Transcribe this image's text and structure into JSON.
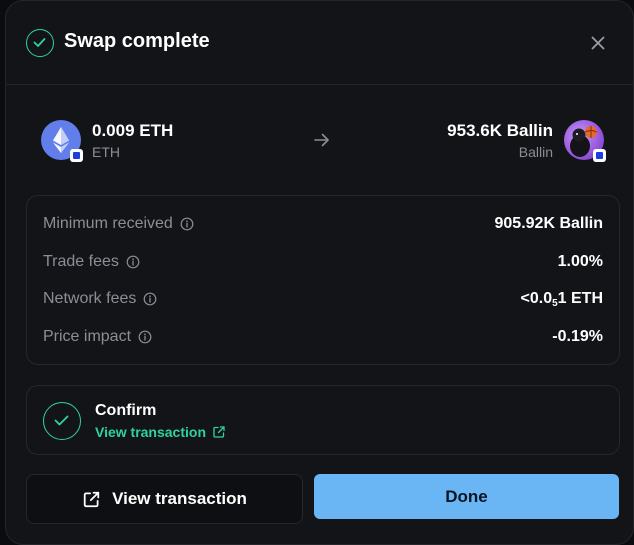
{
  "header": {
    "title": "Swap complete"
  },
  "swap": {
    "from": {
      "amount": "0.009 ETH",
      "symbol": "ETH"
    },
    "to": {
      "amount": "953.6K Ballin",
      "symbol": "Ballin"
    }
  },
  "details": {
    "minimum_received": {
      "label": "Minimum received",
      "value": "905.92K Ballin"
    },
    "trade_fees": {
      "label": "Trade fees",
      "value": "1.00%"
    },
    "network_fees": {
      "label": "Network fees",
      "value_prefix": "<0.0",
      "value_sub": "5",
      "value_suffix": "1 ETH"
    },
    "price_impact": {
      "label": "Price impact",
      "value": "-0.19%"
    }
  },
  "confirm": {
    "title": "Confirm",
    "link": "View transaction"
  },
  "buttons": {
    "view_transaction": "View transaction",
    "done": "Done"
  },
  "colors": {
    "accent_green": "#2fd39a",
    "primary_button": "#6ab6f4",
    "eth_blue": "#627eea"
  },
  "icons": [
    "check-icon",
    "close-icon",
    "eth-icon",
    "ballin-token-icon",
    "arrow-right-icon",
    "info-icon",
    "external-link-icon"
  ]
}
